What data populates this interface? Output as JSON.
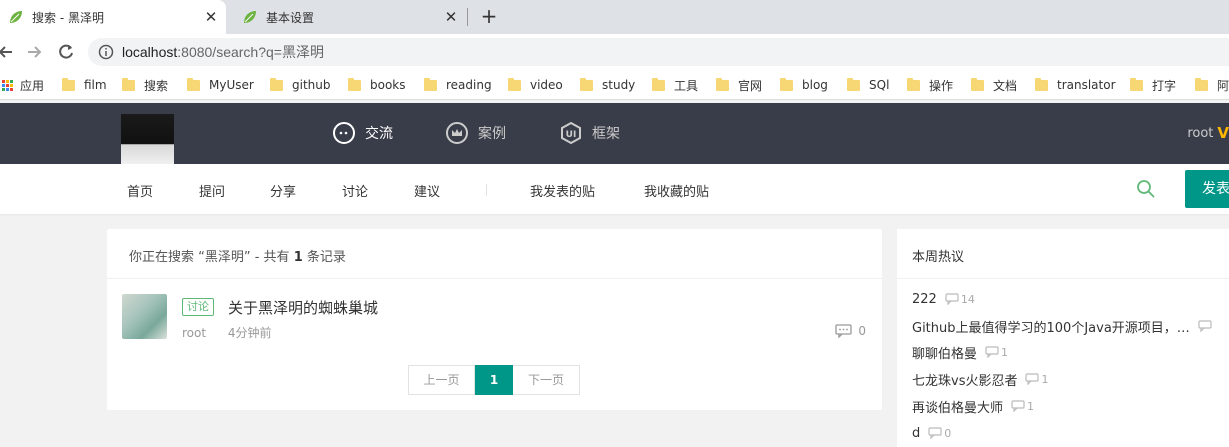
{
  "browser": {
    "tabs": [
      {
        "title": "搜索 - 黑泽明",
        "active": true
      },
      {
        "title": "基本设置",
        "active": false
      }
    ],
    "new_tab_label": "+",
    "close_glyph": "✕",
    "url_host": "localhost",
    "url_rest": ":8080/search?q=黑泽明",
    "bookmarks": [
      "应用",
      "film",
      "搜索",
      "MyUser",
      "github",
      "books",
      "reading",
      "video",
      "study",
      "工具",
      "官网",
      "blog",
      "SQl",
      "操作",
      "文档",
      "translator",
      "打字",
      "阿"
    ]
  },
  "header": {
    "nav": [
      {
        "label": "交流",
        "icon": "chat-bubble-icon"
      },
      {
        "label": "案例",
        "icon": "crown-icon"
      },
      {
        "label": "框架",
        "icon": "ui-framework-icon"
      }
    ],
    "user": "root",
    "vip_mark": "V"
  },
  "subnav": {
    "items": [
      "首页",
      "提问",
      "分享",
      "讨论",
      "建议"
    ],
    "user_items": [
      "我发表的贴",
      "我收藏的贴"
    ],
    "post_button": "发表"
  },
  "search": {
    "prefix": "你正在搜索 “黑泽明” - 共有 ",
    "count": "1",
    "suffix": " 条记录"
  },
  "results": [
    {
      "badge": "讨论",
      "title": "关于黑泽明的蜘蛛巢城",
      "author": "root",
      "time": "4分钟前",
      "replies": "0"
    }
  ],
  "pager": {
    "prev": "上一页",
    "current": "1",
    "next": "下一页"
  },
  "hot": {
    "title": "本周热议",
    "items": [
      {
        "title": "222",
        "count": "14"
      },
      {
        "title": "Github上最值得学习的100个Java开源项目，…",
        "count": ""
      },
      {
        "title": "聊聊伯格曼",
        "count": "1"
      },
      {
        "title": "七龙珠vs火影忍者",
        "count": "1"
      },
      {
        "title": "再谈伯格曼大师",
        "count": "1"
      },
      {
        "title": "d",
        "count": "0"
      }
    ]
  },
  "colors": {
    "accent": "#009688",
    "header_bg": "#393d49",
    "badge_green": "#5fb878",
    "vip_gold": "#ffb800"
  }
}
